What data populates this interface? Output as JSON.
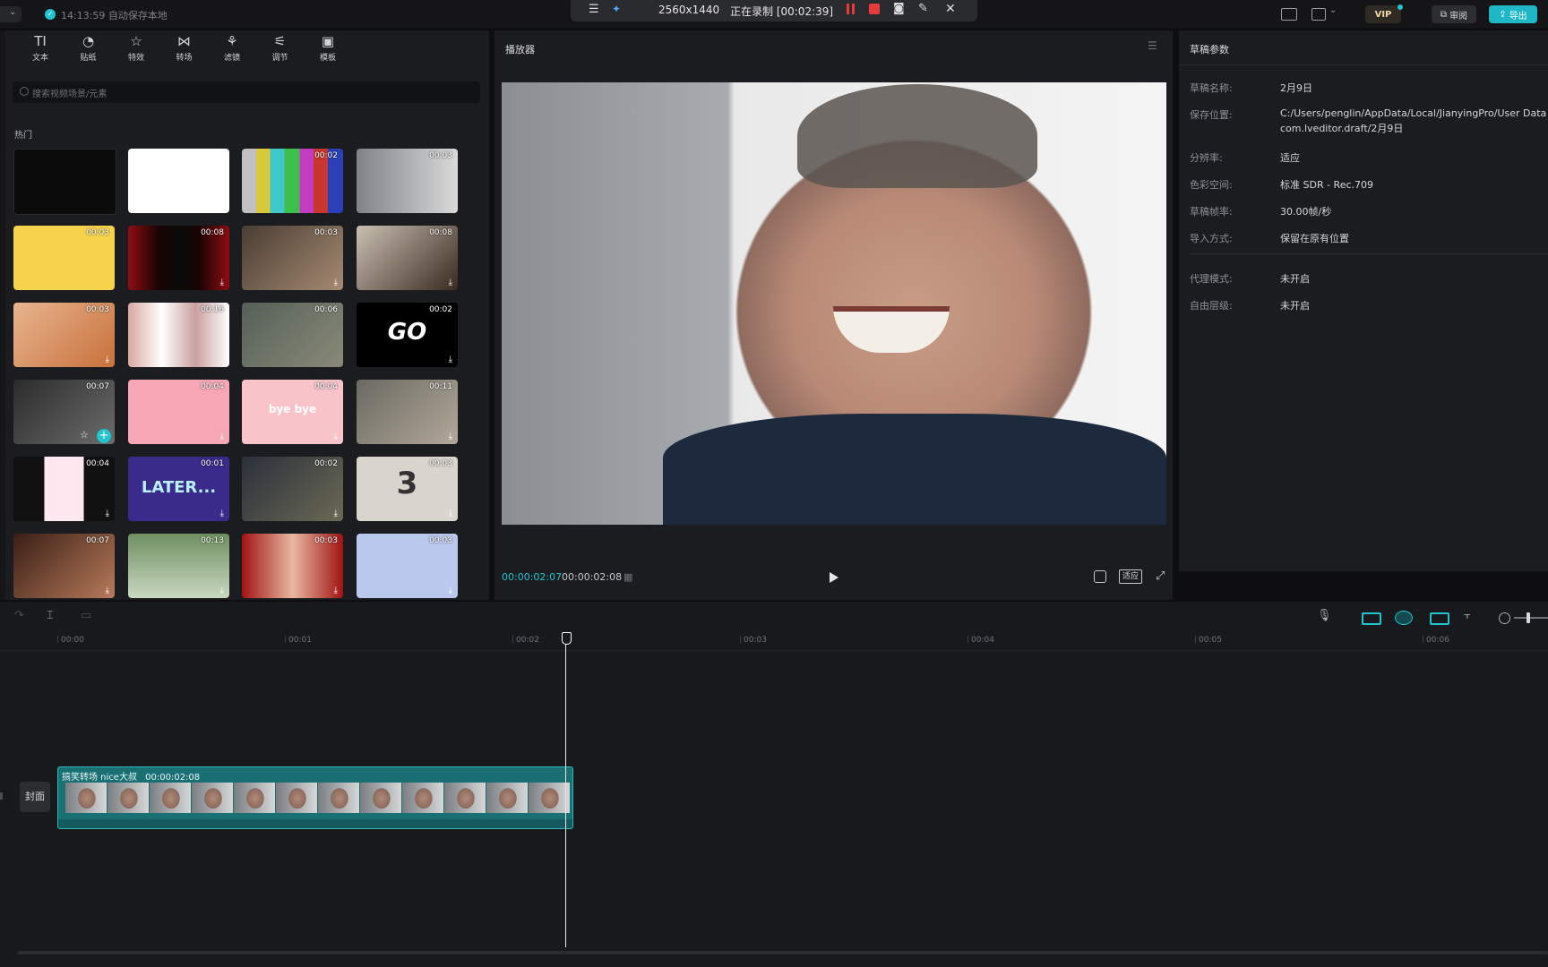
{
  "app": {
    "autosave": "14:13:59 自动保存本地",
    "menu_label": "菜单"
  },
  "recorder": {
    "resolution": "2560x1440",
    "status": "正在录制 [00:02:39]"
  },
  "top_right": {
    "vip": "VIP",
    "review": "审阅",
    "export": "导出"
  },
  "toolbar": [
    {
      "icon": "TI",
      "label": "文本"
    },
    {
      "icon": "◔",
      "label": "贴纸"
    },
    {
      "icon": "☆",
      "label": "特效"
    },
    {
      "icon": "⋈",
      "label": "转场"
    },
    {
      "icon": "⚘",
      "label": "滤镜"
    },
    {
      "icon": "⚟",
      "label": "调节"
    },
    {
      "icon": "▣",
      "label": "模板"
    }
  ],
  "library": {
    "search_placeholder": "搜索视频场景/元素",
    "section": "热门",
    "items": [
      {
        "dur": "",
        "bg": "#0b0b0b",
        "text": "",
        "dl": false
      },
      {
        "dur": "",
        "bg": "#ffffff",
        "text": "",
        "dl": false
      },
      {
        "dur": "00:02",
        "bg": "bars",
        "text": "",
        "dl": false
      },
      {
        "dur": "00:03",
        "bg": "linear-gradient(90deg,#7f8388,#d9d9d9)",
        "text": "",
        "dl": false
      },
      {
        "dur": "00:03",
        "bg": "#f6d34a",
        "text": "",
        "dl": false
      },
      {
        "dur": "00:08",
        "bg": "linear-gradient(90deg,#8f0d12 0%,#1a0304 30%,#0a0a0a 50%,#1a0304 70%,#8f0d12 100%)",
        "text": "",
        "dl": true
      },
      {
        "dur": "00:03",
        "bg": "linear-gradient(135deg,#4a3d33,#a58a72)",
        "text": "",
        "dl": true
      },
      {
        "dur": "00:08",
        "bg": "linear-gradient(135deg,#c9c0b2,#3a2a20)",
        "text": "",
        "dl": true
      },
      {
        "dur": "00:03",
        "bg": "linear-gradient(135deg,#e8b58f,#c8703b)",
        "text": "",
        "dl": true
      },
      {
        "dur": "00:16",
        "bg": "linear-gradient(90deg,#d9a8a0,#fff,#caa0a0,#fff)",
        "text": "",
        "dl": false
      },
      {
        "dur": "00:06",
        "bg": "linear-gradient(135deg,#556058,#8a8a78)",
        "text": "",
        "dl": false
      },
      {
        "dur": "00:02",
        "bg": "#000000",
        "text": "GO",
        "dl": true
      },
      {
        "dur": "00:07",
        "bg": "linear-gradient(135deg,#2b2b2b,#6c6c6c)",
        "text": "",
        "dl": false
      },
      {
        "dur": "00:04",
        "bg": "#f7a6b5",
        "text": "",
        "dl": true
      },
      {
        "dur": "00:04",
        "bg": "#f8c4ca",
        "text": "bye bye",
        "dl": true
      },
      {
        "dur": "00:11",
        "bg": "linear-gradient(135deg,#6a6a62,#b3a89a)",
        "text": "",
        "dl": true
      },
      {
        "dur": "00:04",
        "bg": "linear-gradient(90deg,#111 0%,#111 30%,#ffe8ef 31%,#ffe8ef 69%,#111 70%)",
        "text": "",
        "dl": true
      },
      {
        "dur": "00:01",
        "bg": "#3a2a8a",
        "text": "LATER...",
        "dl": true
      },
      {
        "dur": "00:02",
        "bg": "linear-gradient(135deg,#2b2f3a,#6b6a55)",
        "text": "",
        "dl": true
      },
      {
        "dur": "00:03",
        "bg": "#d9d4cc",
        "text": "3",
        "dl": true
      },
      {
        "dur": "00:07",
        "bg": "linear-gradient(135deg,#3a1f16,#b77a5a)",
        "text": "",
        "dl": true
      },
      {
        "dur": "00:13",
        "bg": "linear-gradient(180deg,#6f8f60,#c9d8c0)",
        "text": "",
        "dl": true
      },
      {
        "dur": "00:03",
        "bg": "linear-gradient(90deg,#a11313,#e8b8a0,#a11313)",
        "text": "",
        "dl": true
      },
      {
        "dur": "00:03",
        "bg": "#b9c8ec",
        "text": "",
        "dl": true
      }
    ]
  },
  "player": {
    "title": "播放器",
    "current_time": "00:00:02:07",
    "total_time": "00:00:02:08",
    "fit_label": "适应"
  },
  "properties": {
    "title": "草稿参数",
    "rows": [
      {
        "label": "草稿名称:",
        "value": "2月9日"
      },
      {
        "label": "保存位置:",
        "value": "C:/Users/penglin/AppData/Local/JianyingPro/User Data",
        "value2": "com.lveditor.draft/2月9日"
      },
      {
        "label": "分辨率:",
        "value": "适应"
      },
      {
        "label": "色彩空间:",
        "value": "标准 SDR - Rec.709"
      },
      {
        "label": "草稿帧率:",
        "value": "30.00帧/秒"
      },
      {
        "label": "导入方式:",
        "value": "保留在原有位置"
      },
      {
        "label": "代理模式:",
        "value": "未开启"
      },
      {
        "label": "自由层级:",
        "value": "未开启"
      }
    ]
  },
  "timeline": {
    "ruler": [
      "00:00",
      "00:01",
      "00:02",
      "00:03",
      "00:04",
      "00:05",
      "00:06"
    ],
    "cover_label": "封面",
    "clip_label": "搞笑转场 nice大叔",
    "clip_duration": "00:00:02:08"
  },
  "colors": {
    "accent": "#22c4cf",
    "panel": "#1b1c1f",
    "clip": "#1a6f73",
    "rec_red": "#e63b3b"
  }
}
